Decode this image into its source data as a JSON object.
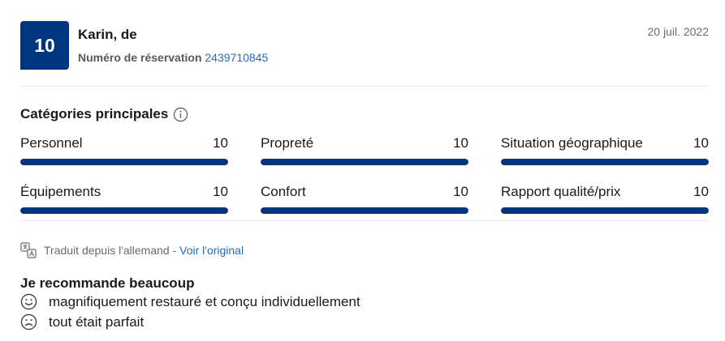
{
  "review": {
    "score": "10",
    "reviewer": "Karin, de",
    "reservation_label": "Numéro de réservation",
    "reservation_number": "2439710845",
    "date": "20 juil. 2022"
  },
  "categories": {
    "title": "Catégories principales",
    "items": [
      {
        "label": "Personnel",
        "score": "10",
        "fill": 1.0
      },
      {
        "label": "Propreté",
        "score": "10",
        "fill": 1.0
      },
      {
        "label": "Situation géographique",
        "score": "10",
        "fill": 1.0
      },
      {
        "label": "Équipements",
        "score": "10",
        "fill": 1.0
      },
      {
        "label": "Confort",
        "score": "10",
        "fill": 1.0
      },
      {
        "label": "Rapport qualité/prix",
        "score": "10",
        "fill": 1.0
      }
    ]
  },
  "translation": {
    "text": "Traduit depuis l'allemand",
    "separator": " - ",
    "link": "Voir l'original"
  },
  "comments": {
    "title": "Je recommande beaucoup",
    "positive": "magnifiquement restauré et conçu individuellement",
    "negative": "tout était parfait"
  },
  "colors": {
    "brand": "#003580",
    "link": "#1d6cc6"
  },
  "icons": [
    "info-icon",
    "translate-icon",
    "smiley-happy-icon",
    "smiley-sad-icon"
  ]
}
